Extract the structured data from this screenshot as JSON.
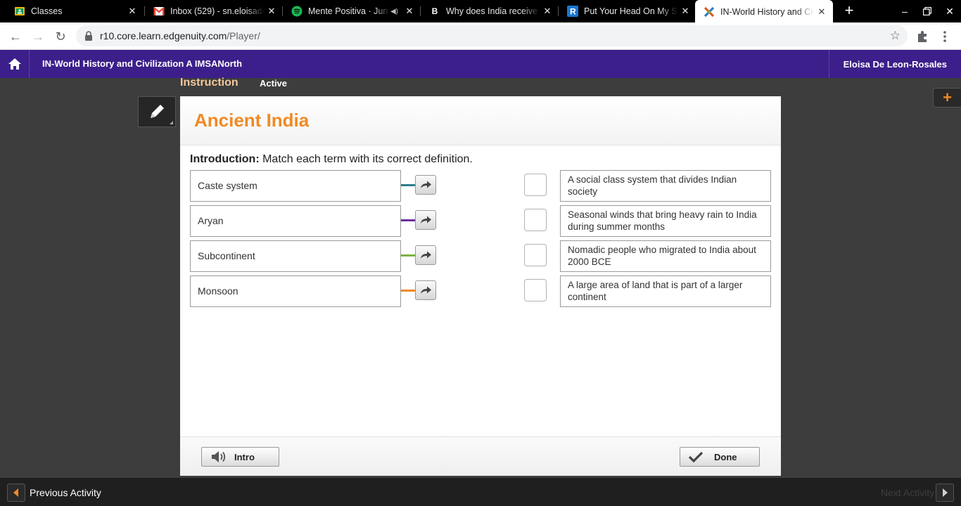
{
  "browser": {
    "tabs": [
      {
        "title": "Classes",
        "icon": "google-classroom-icon",
        "active": false
      },
      {
        "title": "Inbox (529) - sn.eloisade",
        "icon": "gmail-icon",
        "active": false
      },
      {
        "title": "Mente Positiva · Jun",
        "icon": "spotify-icon",
        "active": false,
        "audio": true
      },
      {
        "title": "Why does India receive m",
        "icon": "brainly-icon",
        "active": false
      },
      {
        "title": "Put Your Head On My Sh",
        "icon": "r-icon",
        "active": false
      },
      {
        "title": "IN-World History and Civ",
        "icon": "edgenuity-icon",
        "active": true
      }
    ],
    "url_host": "r10.core.learn.edgenuity.com",
    "url_path": "/Player/"
  },
  "app_header": {
    "course_title": "IN-World History and Civilization A IMSANorth",
    "user_name": "Eloisa De Leon-Rosales"
  },
  "stage": {
    "section_label": "Instruction",
    "status_label": "Active"
  },
  "activity": {
    "title": "Ancient India",
    "intro_label": "Introduction:",
    "intro_text": " Match each term with its correct definition.",
    "terms": [
      {
        "label": "Caste system",
        "color": "#2e7d8a"
      },
      {
        "label": "Aryan",
        "color": "#6a2fa0"
      },
      {
        "label": "Subcontinent",
        "color": "#7cb342"
      },
      {
        "label": "Monsoon",
        "color": "#f08a24"
      }
    ],
    "definitions": [
      "A social class system that divides Indian society",
      "Seasonal winds that bring heavy rain to India during summer months",
      "Nomadic people who migrated to India about 2000 BCE",
      "A large area of land that is part of a larger continent"
    ],
    "intro_button_label": "Intro",
    "done_button_label": "Done"
  },
  "footer": {
    "previous_label": "Previous Activity",
    "next_label": "Next Activity"
  },
  "colors": {
    "header_purple": "#3c1f8a",
    "title_orange": "#f08a24"
  }
}
